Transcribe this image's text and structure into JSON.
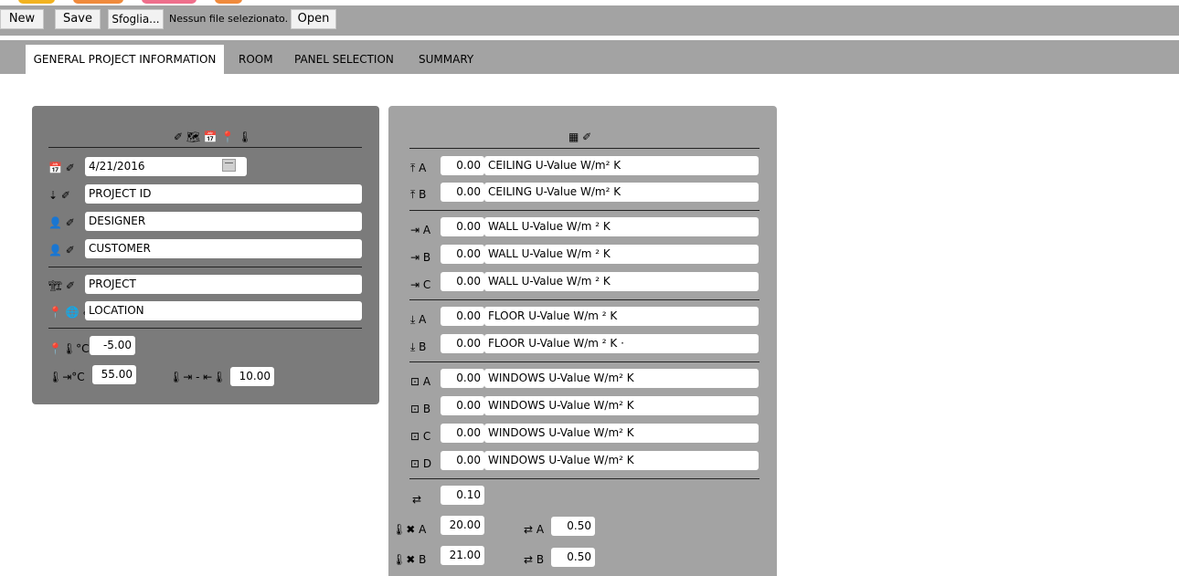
{
  "colors": {
    "toolbar": "#a3a3a3",
    "left_panel": "#7b7b7b",
    "right_panel": "#a3a3a3",
    "field": "#ffffff",
    "logo_yellow": "#f2b320",
    "logo_orange": "#f08a3c",
    "logo_pink": "#ef6f8c"
  },
  "toolbar": {
    "new_label": "New",
    "save_label": "Save",
    "browse_label": "Sfoglia...",
    "file_status": "Nessun file selezionato.",
    "open_label": "Open"
  },
  "tabs": [
    {
      "label": "GENERAL PROJECT INFORMATION",
      "active": true
    },
    {
      "label": "ROOM",
      "active": false
    },
    {
      "label": "PANEL SELECTION",
      "active": false
    },
    {
      "label": "SUMMARY",
      "active": false
    }
  ],
  "general": {
    "header_icons": "✐ 🗺 📅 📍 🌡",
    "rows": [
      {
        "icons": "📅 ✐",
        "value": "4/21/2016",
        "icon_name": "calendar-icon"
      },
      {
        "icons": "⇣ ✐",
        "value": "PROJECT ID",
        "icon_name": "sort-icon"
      },
      {
        "icons": "👤 ✐",
        "value": "DESIGNER",
        "icon_name": "user-add-icon"
      },
      {
        "icons": "👤 ✐",
        "value": "CUSTOMER",
        "icon_name": "user-icon"
      },
      {
        "icons": "🏗 ✐",
        "value": "PROJECT",
        "icon_name": "building-icon"
      },
      {
        "icons": "📍 🌐 ✐",
        "value": "LOCATION",
        "icon_name": "location-icon"
      }
    ],
    "outdoor_temp": {
      "label": "📍🌡°C",
      "value": "-5.00"
    },
    "indoor_temp": {
      "label": "🌡⇥°C",
      "value": "55.00"
    },
    "delta_temp": {
      "label": "🌡⇥ - ⇤🌡",
      "value": "10.00"
    }
  },
  "room": {
    "header_icons": "▦ ✐",
    "groups": [
      [
        {
          "label": "A",
          "icon_name": "ceiling-icon",
          "value": "0.00",
          "desc": "CEILING U-Value W/m² K"
        },
        {
          "label": "B",
          "icon_name": "ceiling-icon",
          "value": "0.00",
          "desc": "CEILING U-Value W/m² K"
        }
      ],
      [
        {
          "label": "A",
          "icon_name": "wall-icon",
          "value": "0.00",
          "desc": "WALL U-Value W/m ² K"
        },
        {
          "label": "B",
          "icon_name": "wall-icon",
          "value": "0.00",
          "desc": "WALL U-Value W/m ² K"
        },
        {
          "label": "C",
          "icon_name": "wall-icon",
          "value": "0.00",
          "desc": "WALL U-Value W/m ² K"
        }
      ],
      [
        {
          "label": "A",
          "icon_name": "floor-icon",
          "value": "0.00",
          "desc": "FLOOR U-Value W/m ² K"
        },
        {
          "label": "B",
          "icon_name": "floor-icon",
          "value": "0.00",
          "desc": "FLOOR U-Value W/m ² K ·"
        }
      ],
      [
        {
          "label": "A",
          "icon_name": "window-icon",
          "value": "0.00",
          "desc": "WINDOWS U-Value W/m² K"
        },
        {
          "label": "B",
          "icon_name": "window-icon",
          "value": "0.00",
          "desc": "WINDOWS U-Value W/m² K"
        },
        {
          "label": "C",
          "icon_name": "window-icon",
          "value": "0.00",
          "desc": "WINDOWS U-Value W/m² K"
        },
        {
          "label": "D",
          "icon_name": "window-icon",
          "value": "0.00",
          "desc": "WINDOWS U-Value W/m² K"
        }
      ]
    ],
    "air_change": {
      "value": "0.10"
    },
    "ventA": {
      "label": "A",
      "temp": "20.00",
      "exch_label": "A",
      "exch": "0.50"
    },
    "ventB": {
      "label": "B",
      "temp": "21.00",
      "exch_label": "B",
      "exch": "0.50"
    }
  }
}
